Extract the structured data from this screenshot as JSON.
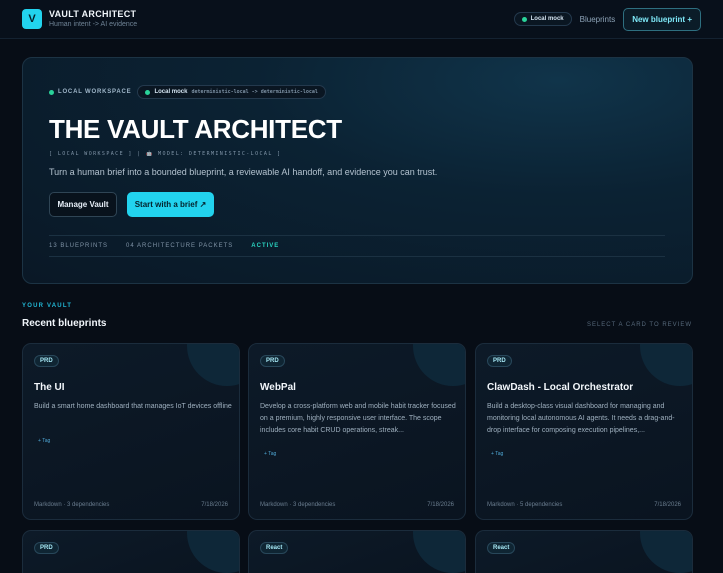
{
  "header": {
    "logo_letter": "V",
    "app_title": "VAULT ARCHITECT",
    "app_subtitle": "Human intent -> AI evidence",
    "status_pill": "Local mock",
    "nav_blueprints": "Blueprints",
    "new_blueprint": "New blueprint +"
  },
  "hero": {
    "workspace_tag": "LOCAL WORKSPACE",
    "mode_pill": "Local mock",
    "mode_detail": "deterministic-local -> deterministic-local",
    "title": "THE VAULT ARCHITECT",
    "meta": "[ LOCAL WORKSPACE ] | 🤖 MODEL: DETERMINISTIC-LOCAL ]",
    "description": "Turn a human brief into a bounded blueprint, a reviewable AI handoff, and evidence you can trust.",
    "manage_button": "Manage Vault",
    "start_button": "Start with a brief ↗",
    "stats": {
      "blueprints": "13 BLUEPRINTS",
      "packets": "04 ARCHITECTURE PACKETS",
      "status": "ACTIVE"
    }
  },
  "section": {
    "eyebrow": "YOUR VAULT",
    "title": "Recent blueprints",
    "hint": "SELECT A CARD TO REVIEW"
  },
  "cards": [
    {
      "badge": "PRD",
      "title": "The UI",
      "description": "Build a smart home dashboard that manages IoT devices offline",
      "tag": "+ Tag",
      "footer_left": "Markdown · 3 dependencies",
      "footer_right": "7/18/2026"
    },
    {
      "badge": "PRD",
      "title": "WebPal",
      "description": "Develop a cross-platform web and mobile habit tracker focused on a premium, highly responsive user interface. The scope includes core habit CRUD operations, streak...",
      "tag": "+ Tag",
      "footer_left": "Markdown · 3 dependencies",
      "footer_right": "7/18/2026"
    },
    {
      "badge": "PRD",
      "title": "ClawDash - Local Orchestrator",
      "description": "Build a desktop-class visual dashboard for managing and monitoring local autonomous AI agents. It needs a drag-and-drop interface for composing execution pipelines,...",
      "tag": "+ Tag",
      "footer_left": "Markdown · 5 dependencies",
      "footer_right": "7/18/2026"
    },
    {
      "badge": "PRD"
    },
    {
      "badge": "React"
    },
    {
      "badge": "React"
    }
  ],
  "colors": {
    "accent": "#22d3ee",
    "status_green": "#2ad39a",
    "background": "#070d16"
  }
}
